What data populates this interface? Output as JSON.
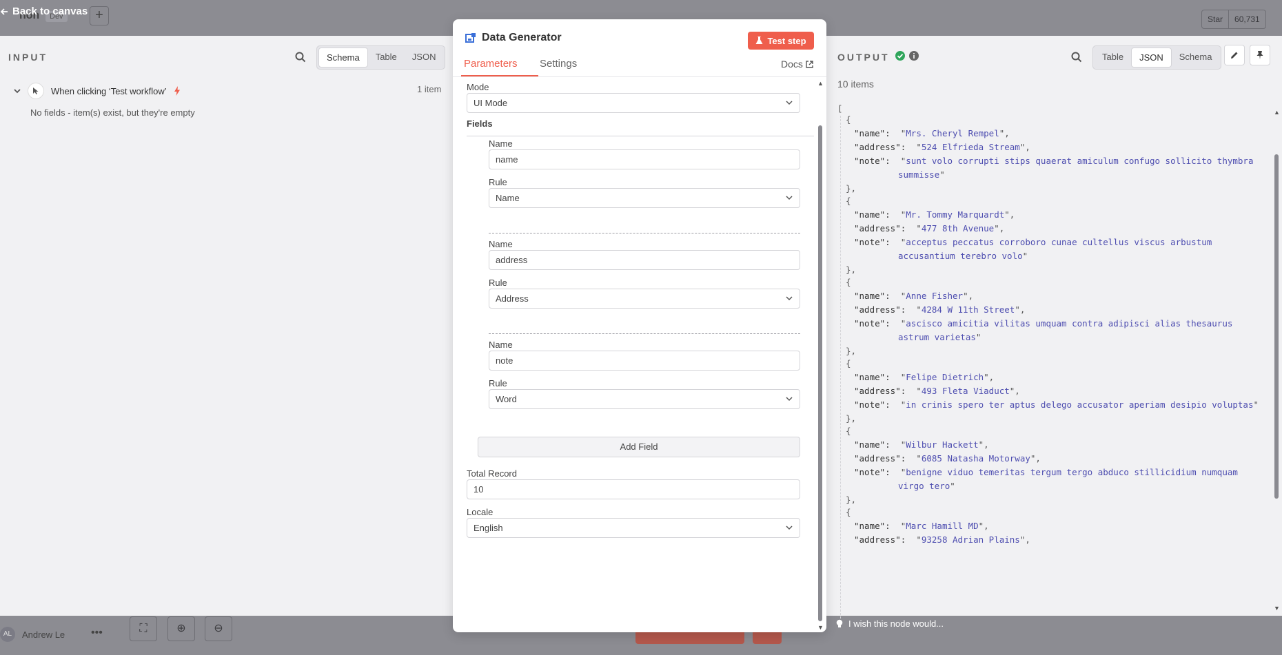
{
  "background": {
    "workflow_name": "non",
    "workflow_tag": "Dev",
    "github_star": "Star",
    "github_count": "60,731",
    "user_initials": "AL",
    "user_name": "Andrew Le"
  },
  "back_link": "Back to canvas",
  "input": {
    "title": "INPUT",
    "view_tabs": [
      "Schema",
      "Table",
      "JSON"
    ],
    "active_tab": "Schema",
    "trigger_label": "When clicking ‘Test workflow’",
    "item_count": "1 item",
    "empty_message": "No fields - item(s) exist, but they're empty"
  },
  "node": {
    "title": "Data Generator",
    "test_step": "Test step",
    "tabs": [
      "Parameters",
      "Settings"
    ],
    "active_tab": "Parameters",
    "docs": "Docs",
    "accent_color": "#ef5e4c"
  },
  "params": {
    "mode_label": "Mode",
    "mode_value": "UI Mode",
    "fields_label": "Fields",
    "field_entries": [
      {
        "name_label": "Name",
        "name_value": "name",
        "rule_label": "Rule",
        "rule_value": "Name"
      },
      {
        "name_label": "Name",
        "name_value": "address",
        "rule_label": "Rule",
        "rule_value": "Address"
      },
      {
        "name_label": "Name",
        "name_value": "note",
        "rule_label": "Rule",
        "rule_value": "Word"
      }
    ],
    "add_field": "Add Field",
    "total_record_label": "Total Record",
    "total_record_value": "10",
    "locale_label": "Locale",
    "locale_value": "English"
  },
  "output": {
    "title": "OUTPUT",
    "view_tabs": [
      "Table",
      "JSON",
      "Schema"
    ],
    "active_tab": "JSON",
    "items_count": "10 items",
    "status_icon": "check-circle-icon",
    "records": [
      {
        "name": "Mrs. Cheryl Rempel",
        "address": "524 Elfrieda Stream",
        "note_line1": "sunt volo corrupti stips quaerat amiculum confugo sollicito thymbra",
        "note_line2": "summisse"
      },
      {
        "name": "Mr. Tommy Marquardt",
        "address": "477 8th Avenue",
        "note_line1": "acceptus peccatus corroboro cunae cultellus viscus arbustum",
        "note_line2": "accusantium terebro volo"
      },
      {
        "name": "Anne Fisher",
        "address": "4284 W 11th Street",
        "note_line1": "ascisco amicitia vilitas umquam contra adipisci alias thesaurus",
        "note_line2": "astrum varietas"
      },
      {
        "name": "Felipe Dietrich",
        "address": "493 Fleta Viaduct",
        "note_line1": "in crinis spero ter aptus delego accusator aperiam desipio voluptas",
        "note_line2": ""
      },
      {
        "name": "Wilbur Hackett",
        "address": "6085 Natasha Motorway",
        "note_line1": "benigne viduo temeritas tergum tergo abduco stillicidium numquam",
        "note_line2": "virgo tero"
      },
      {
        "name": "Marc Hamill MD",
        "address": "93258 Adrian Plains",
        "note_line1": "",
        "note_line2": ""
      }
    ],
    "wish_text": "I wish this node would..."
  }
}
